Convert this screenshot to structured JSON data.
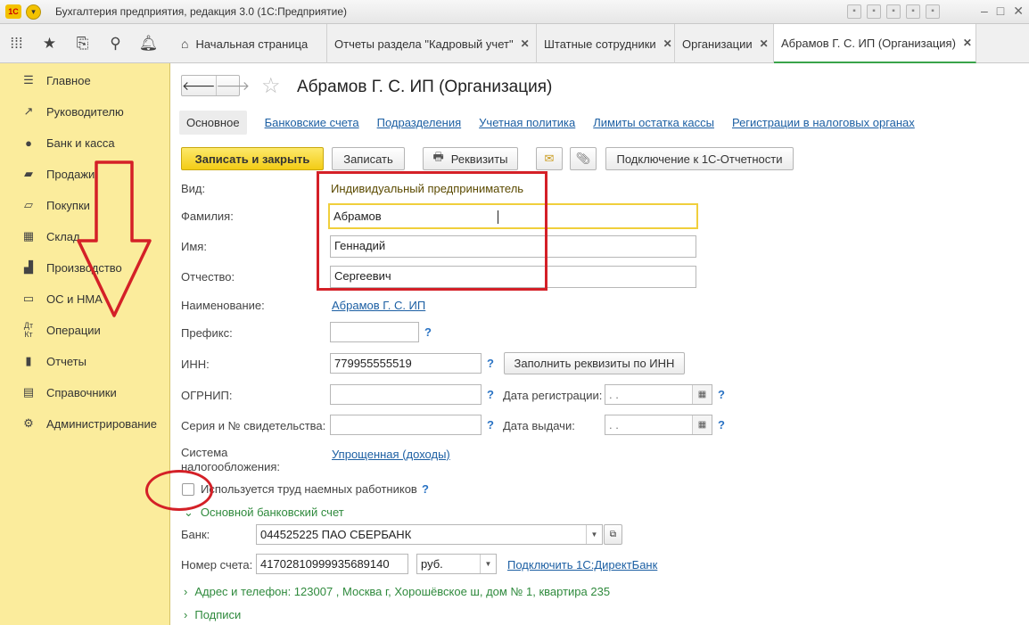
{
  "window": {
    "title": "Бухгалтерия предприятия, редакция 3.0  (1С:Предприятие)",
    "logo_text": "1С"
  },
  "tabs": [
    {
      "label": "Начальная страница",
      "closable": false
    },
    {
      "label": "Отчеты раздела \"Кадровый учет\"",
      "closable": true
    },
    {
      "label": "Штатные сотрудники",
      "closable": true
    },
    {
      "label": "Организации",
      "closable": true
    },
    {
      "label": "Абрамов Г. С. ИП (Организация)",
      "closable": true,
      "active": true
    }
  ],
  "sidebar": {
    "items": [
      {
        "label": "Главное",
        "icon": "menu-icon"
      },
      {
        "label": "Руководителю",
        "icon": "trend-icon"
      },
      {
        "label": "Банк и касса",
        "icon": "coin-icon"
      },
      {
        "label": "Продажи",
        "icon": "cart-icon"
      },
      {
        "label": "Покупки",
        "icon": "basket-icon"
      },
      {
        "label": "Склад",
        "icon": "warehouse-icon"
      },
      {
        "label": "Производство",
        "icon": "factory-icon"
      },
      {
        "label": "ОС и НМА",
        "icon": "os-icon"
      },
      {
        "label": "Операции",
        "icon": "operations-icon"
      },
      {
        "label": "Отчеты",
        "icon": "reports-icon"
      },
      {
        "label": "Справочники",
        "icon": "books-icon"
      },
      {
        "label": "Администрирование",
        "icon": "gear-icon"
      }
    ]
  },
  "form": {
    "title": "Абрамов Г. С. ИП (Организация)",
    "subnav": {
      "current": "Основное",
      "links": [
        "Банковские счета",
        "Подразделения",
        "Учетная политика",
        "Лимиты остатка кассы",
        "Регистрации в налоговых органах"
      ]
    },
    "toolbar": {
      "save_close": "Записать и закрыть",
      "save": "Записать",
      "requisites": "Реквизиты",
      "connect": "Подключение к 1С-Отчетности"
    },
    "fields": {
      "vid_label": "Вид:",
      "vid_value": "Индивидуальный предприниматель",
      "surname_label": "Фамилия:",
      "surname_value": "Абрамов",
      "name_label": "Имя:",
      "name_value": "Геннадий",
      "patronymic_label": "Отчество:",
      "patronymic_value": "Сергеевич",
      "naim_label": "Наименование:",
      "naim_value": "Абрамов Г. С. ИП",
      "prefix_label": "Префикс:",
      "prefix_value": "",
      "inn_label": "ИНН:",
      "inn_value": "779955555519",
      "fill_inn_button": "Заполнить реквизиты по ИНН",
      "ogrnip_label": "ОГРНИП:",
      "ogrnip_value": "",
      "reg_date_label": "Дата регистрации:",
      "reg_date_value": " .  .",
      "cert_label": "Серия и № свидетельства:",
      "cert_value": "",
      "issue_date_label": "Дата выдачи:",
      "issue_date_value": " .  .",
      "tax_label_1": "Система",
      "tax_label_2": "налогообложения:",
      "tax_value": "Упрощенная (доходы)",
      "hired_label": "Используется труд наемных работников",
      "hired_checked": false
    },
    "bank_group": {
      "title": "Основной банковский счет",
      "bank_label": "Банк:",
      "bank_value": "044525225 ПАО СБЕРБАНК",
      "account_label": "Номер счета:",
      "account_value": "41702810999935689140",
      "currency_value": "руб.",
      "direct_bank_link": "Подключить 1С:ДиректБанк"
    },
    "address_group": "Адрес и телефон: 123007 , Москва г, Хорошёвское ш, дом № 1, квартира 235",
    "signatures_group": "Подписи",
    "help_mark": "?"
  },
  "colors": {
    "sidebar_bg": "#fbec9c",
    "primary_button": "#f3cc15",
    "link": "#1c5fa3",
    "annotation_red": "#d42027",
    "group_green": "#2f8a3d"
  }
}
